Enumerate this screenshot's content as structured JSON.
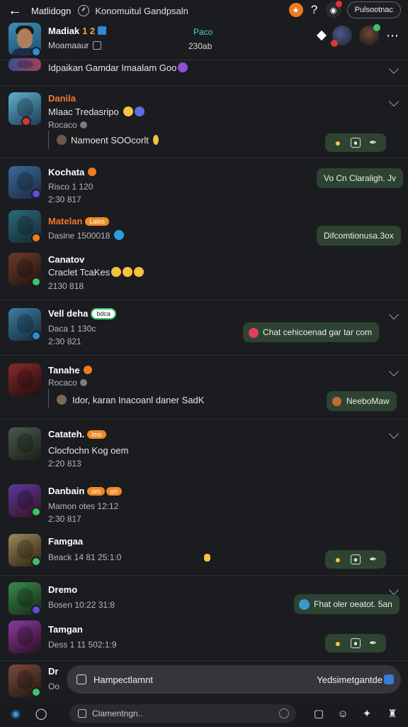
{
  "topbar": {
    "title": "Matlidogn",
    "subtitle": "Konomuitul Gandpsaln",
    "question": "?",
    "pill_label": "Pulsootnac"
  },
  "profile": {
    "name": "Madiak",
    "name_number": "1 2",
    "subline": "Moamaaur",
    "center_top": "Paco",
    "center_bottom": "230ab",
    "more": "⋯"
  },
  "feed": {
    "top_snippet": "Idpaikan Gamdar Imaalam Goo",
    "items": [
      {
        "name": "Danila",
        "line1": "Mlaac Tredasripo",
        "meta": "Rocaco",
        "quote": "Namoent SOOcorlt"
      },
      {
        "name": "Kochata",
        "line1": "Risco 1 120",
        "meta": "2:30 817",
        "bubble": "Vo Cn Claraligh. Jv"
      },
      {
        "name": "Matelan",
        "tag": "Lalos",
        "line1": "Dasine 1500018",
        "bubble": "Difcomtionusa.3ox"
      },
      {
        "name": "Canatov",
        "line1": "Craclet TcaKes",
        "meta": "2130 818"
      },
      {
        "name": "Vell deha",
        "tag": "bdca",
        "line1": "Daca 1 130c",
        "meta": "2:30 821",
        "bubble": "Chat cehicoenad gar tar com"
      },
      {
        "name": "Tanahe",
        "meta": "Rocaco",
        "quote": "Idor, karan Inacoanl daner SadK",
        "bubble": "NeeboMaw"
      },
      {
        "name": "Catateh.",
        "tag": "lmo",
        "line1": "Clocfochn Kog oem",
        "meta": "2:20 813"
      },
      {
        "name": "Danbain",
        "tag": "om",
        "tag2": "on",
        "line1": "Mamon otes 12:12",
        "meta": "2:30 817"
      },
      {
        "name": "Famgaa",
        "meta": "Beack 14 81 25:1:0"
      },
      {
        "name": "Dremo",
        "meta": "Bosen 10:22 31:8",
        "bubble": "Fhat oler oeatot. 5an"
      },
      {
        "name": "Tamgan",
        "meta": "Dess 1 11 502:1:9"
      },
      {
        "name": "Dr",
        "meta": "Oo"
      }
    ]
  },
  "float_search": {
    "left": "Hampectlamnt",
    "right": "Yedsimetgantde"
  },
  "bottom": {
    "placeholder": "Clamentngn.."
  },
  "colors": {
    "background": "#1b1c20",
    "bubble": "#2e4231",
    "accent_orange": "#f07a22",
    "name_orange": "#f0782a",
    "accent_teal": "#4fd0c8",
    "online_green": "#3bc46a",
    "verified_blue": "#2d8bd9"
  }
}
